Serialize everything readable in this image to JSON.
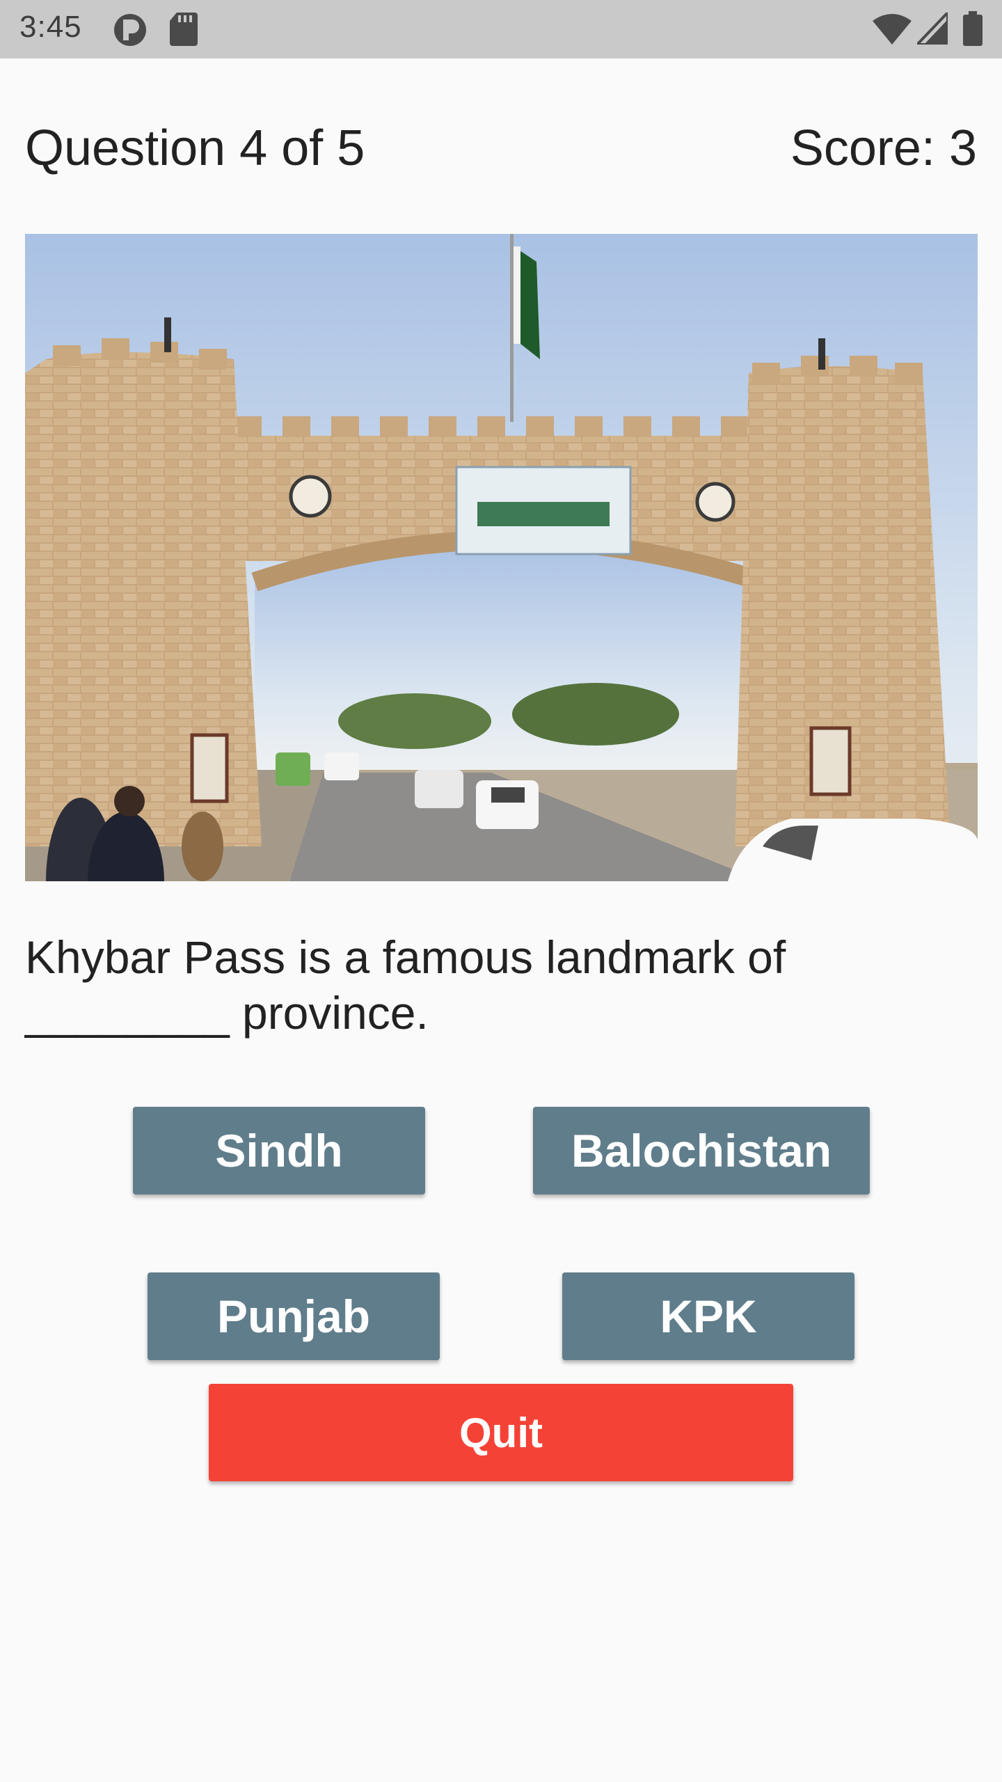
{
  "status_bar": {
    "time": "3:45",
    "icons": [
      "media-icon",
      "sd-card-icon",
      "wifi-icon",
      "signal-icon",
      "battery-icon"
    ]
  },
  "quiz": {
    "question_counter": "Question 4 of 5",
    "score": "Score: 3",
    "image_subject": "Khyber Pass gate",
    "question": "Khybar Pass is a famous landmark of ________ province.",
    "options": [
      "Sindh",
      "Balochistan",
      "Punjab",
      "KPK"
    ],
    "quit_label": "Quit"
  },
  "colors": {
    "status_bar": "#c9c9c9",
    "background": "#fafafa",
    "option_button": "#607d8b",
    "quit_button": "#f44336"
  }
}
